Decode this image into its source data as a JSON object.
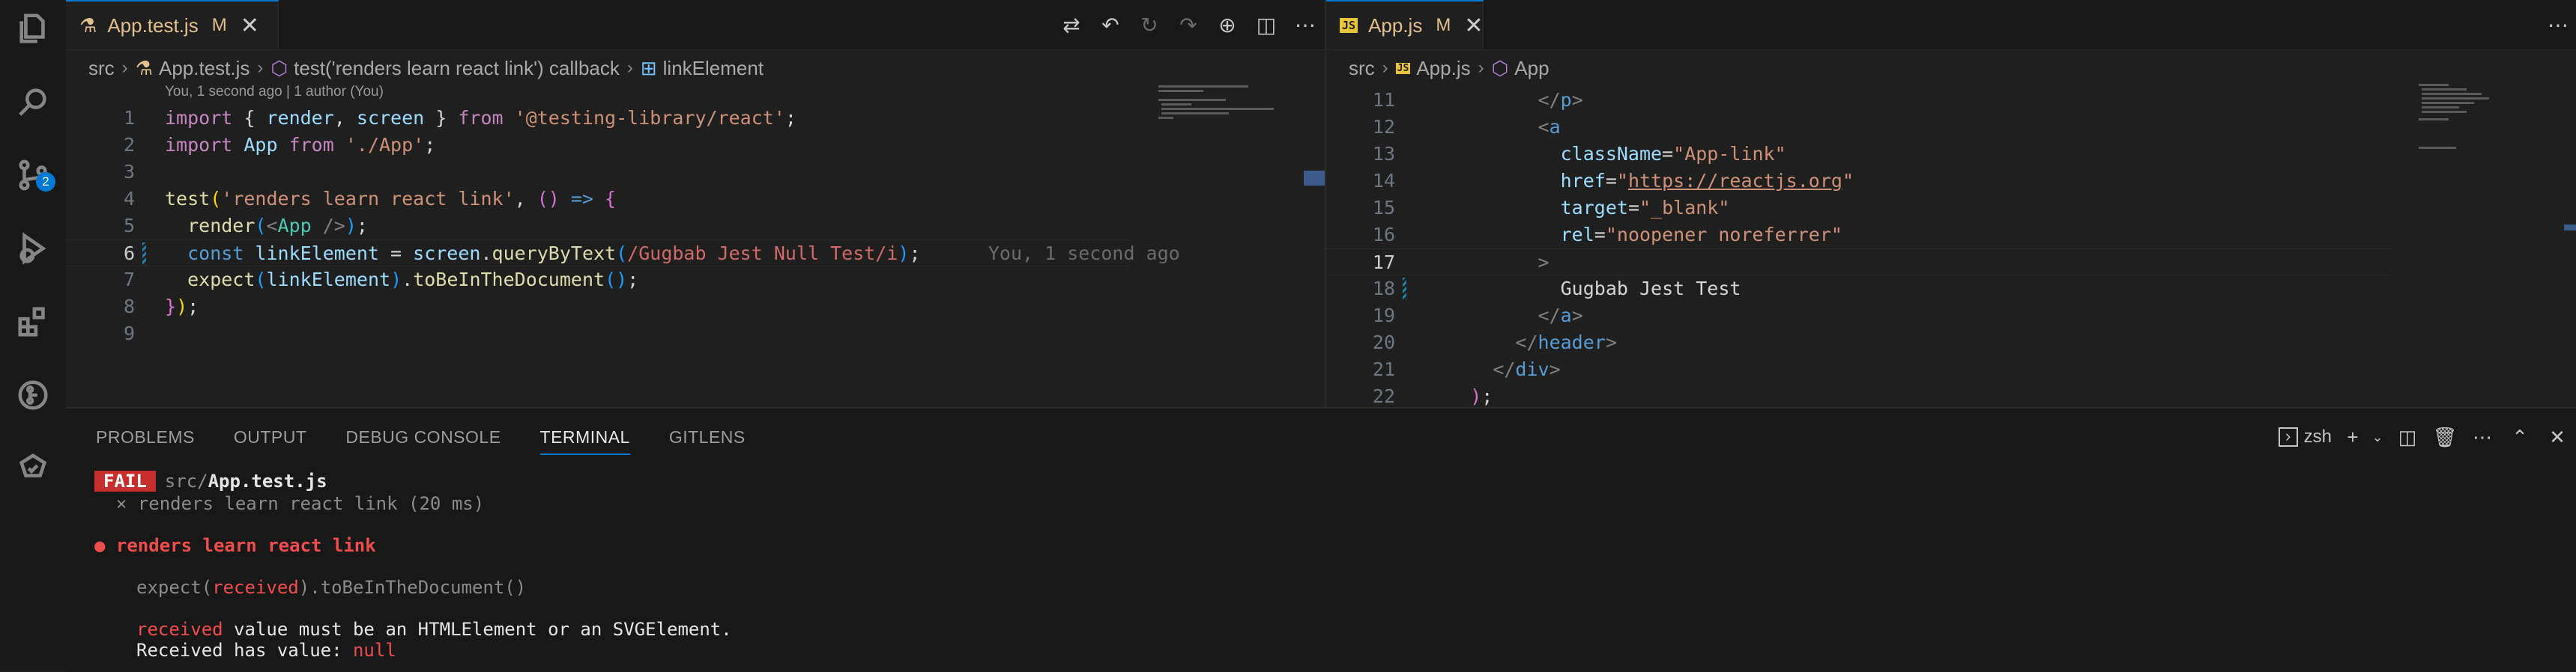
{
  "activity_bar": {
    "items": [
      {
        "name": "explorer-icon"
      },
      {
        "name": "search-icon"
      },
      {
        "name": "source-control-icon",
        "badge": "2"
      },
      {
        "name": "run-debug-icon"
      },
      {
        "name": "extensions-icon"
      },
      {
        "name": "gitlens-icon"
      },
      {
        "name": "testing-icon"
      }
    ]
  },
  "left_editor": {
    "tab": {
      "name": "App.test.js",
      "modified": "M",
      "close": "✕"
    },
    "breadcrumb": {
      "folder": "src",
      "file": "App.test.js",
      "symbol1": "test('renders learn react link') callback",
      "symbol2": "linkElement"
    },
    "codelens": "You, 1 second ago | 1 author (You)",
    "line_numbers": [
      "1",
      "2",
      "3",
      "4",
      "5",
      "6",
      "7",
      "8",
      "9"
    ],
    "current_line": "6",
    "lines": [
      [
        {
          "t": "import ",
          "c": "kw"
        },
        {
          "t": "{ ",
          "c": "pn"
        },
        {
          "t": "render",
          "c": "vr"
        },
        {
          "t": ", ",
          "c": "pn"
        },
        {
          "t": "screen",
          "c": "vr"
        },
        {
          "t": " } ",
          "c": "pn"
        },
        {
          "t": "from ",
          "c": "kw"
        },
        {
          "t": "'@testing-library/react'",
          "c": "st"
        },
        {
          "t": ";",
          "c": "pn"
        }
      ],
      [
        {
          "t": "import ",
          "c": "kw"
        },
        {
          "t": "App ",
          "c": "vr"
        },
        {
          "t": "from ",
          "c": "kw"
        },
        {
          "t": "'./App'",
          "c": "st"
        },
        {
          "t": ";",
          "c": "pn"
        }
      ],
      [],
      [
        {
          "t": "test",
          "c": "fn"
        },
        {
          "t": "(",
          "c": "yl"
        },
        {
          "t": "'renders learn react link'",
          "c": "st"
        },
        {
          "t": ", ",
          "c": "pn"
        },
        {
          "t": "() ",
          "c": "pk"
        },
        {
          "t": "=> ",
          "c": "bl"
        },
        {
          "t": "{",
          "c": "pk"
        }
      ],
      [
        {
          "t": "  render",
          "c": "fn"
        },
        {
          "t": "(",
          "c": "lb"
        },
        {
          "t": "<",
          "c": "tg"
        },
        {
          "t": "App",
          "c": "cl"
        },
        {
          "t": " />",
          "c": "tg"
        },
        {
          "t": ")",
          "c": "lb"
        },
        {
          "t": ";",
          "c": "pn"
        }
      ],
      [
        {
          "t": "  const ",
          "c": "bl"
        },
        {
          "t": "linkElement ",
          "c": "vr"
        },
        {
          "t": "= ",
          "c": "pn"
        },
        {
          "t": "screen",
          "c": "vr"
        },
        {
          "t": ".",
          "c": "pn"
        },
        {
          "t": "queryByText",
          "c": "fn"
        },
        {
          "t": "(",
          "c": "lb"
        },
        {
          "t": "/Gugbab Jest Null Test/i",
          "c": "rx"
        },
        {
          "t": ")",
          "c": "lb"
        },
        {
          "t": ";",
          "c": "pn"
        },
        {
          "t": "      You, 1 second ago",
          "c": "ghost"
        }
      ],
      [
        {
          "t": "  expect",
          "c": "fn"
        },
        {
          "t": "(",
          "c": "lb"
        },
        {
          "t": "linkElement",
          "c": "vr"
        },
        {
          "t": ")",
          "c": "lb"
        },
        {
          "t": ".",
          "c": "pn"
        },
        {
          "t": "toBeInTheDocument",
          "c": "fn"
        },
        {
          "t": "()",
          "c": "lb"
        },
        {
          "t": ";",
          "c": "pn"
        }
      ],
      [
        {
          "t": "}",
          "c": "pk"
        },
        {
          "t": ")",
          "c": "yl"
        },
        {
          "t": ";",
          "c": "pn"
        }
      ],
      []
    ]
  },
  "right_editor": {
    "tab": {
      "name": "App.js",
      "modified": "M",
      "close": "✕"
    },
    "breadcrumb": {
      "folder": "src",
      "file": "App.js",
      "symbol1": "App"
    },
    "line_numbers": [
      "11",
      "12",
      "13",
      "14",
      "15",
      "16",
      "17",
      "18",
      "19",
      "20",
      "21",
      "22"
    ],
    "current_line": "17",
    "lines": [
      [
        {
          "t": "          </",
          "c": "tg"
        },
        {
          "t": "p",
          "c": "bl"
        },
        {
          "t": ">",
          "c": "tg"
        }
      ],
      [
        {
          "t": "          <",
          "c": "tg"
        },
        {
          "t": "a",
          "c": "bl"
        }
      ],
      [
        {
          "t": "            className",
          "c": "vr"
        },
        {
          "t": "=",
          "c": "pn"
        },
        {
          "t": "\"App-link\"",
          "c": "st"
        }
      ],
      [
        {
          "t": "            href",
          "c": "vr"
        },
        {
          "t": "=",
          "c": "pn"
        },
        {
          "t": "\"",
          "c": "st"
        },
        {
          "t": "https://reactjs.org",
          "c": "st"
        },
        {
          "t": "\"",
          "c": "st"
        }
      ],
      [
        {
          "t": "            target",
          "c": "vr"
        },
        {
          "t": "=",
          "c": "pn"
        },
        {
          "t": "\"_blank\"",
          "c": "st"
        }
      ],
      [
        {
          "t": "            rel",
          "c": "vr"
        },
        {
          "t": "=",
          "c": "pn"
        },
        {
          "t": "\"noopener noreferrer\"",
          "c": "st"
        }
      ],
      [
        {
          "t": "          >",
          "c": "tg"
        }
      ],
      [
        {
          "t": "            Gugbab Jest Test",
          "c": "pn"
        }
      ],
      [
        {
          "t": "          </",
          "c": "tg"
        },
        {
          "t": "a",
          "c": "bl"
        },
        {
          "t": ">",
          "c": "tg"
        }
      ],
      [
        {
          "t": "        </",
          "c": "tg"
        },
        {
          "t": "header",
          "c": "bl"
        },
        {
          "t": ">",
          "c": "tg"
        }
      ],
      [
        {
          "t": "      </",
          "c": "tg"
        },
        {
          "t": "div",
          "c": "bl"
        },
        {
          "t": ">",
          "c": "tg"
        }
      ],
      [
        {
          "t": "    )",
          "c": "pk"
        },
        {
          "t": ";",
          "c": "pn"
        }
      ]
    ]
  },
  "panel": {
    "tabs": [
      "PROBLEMS",
      "OUTPUT",
      "DEBUG CONSOLE",
      "TERMINAL",
      "GITLENS"
    ],
    "active_tab": "TERMINAL",
    "shell": "zsh",
    "terminal": {
      "fail_badge": "FAIL",
      "fail_path_prefix": "src/",
      "fail_path_file": "App.test.js",
      "test_result": "  × renders learn react link (20 ms)",
      "failed_title": "● renders learn react link",
      "expect_pre": "expect(",
      "expect_received": "received",
      "expect_post": ").toBeInTheDocument()",
      "msg_received": "received",
      "msg_rest": " value must be an HTMLElement or an SVGElement.",
      "received_label": "Received has value: ",
      "received_value": "null"
    }
  }
}
